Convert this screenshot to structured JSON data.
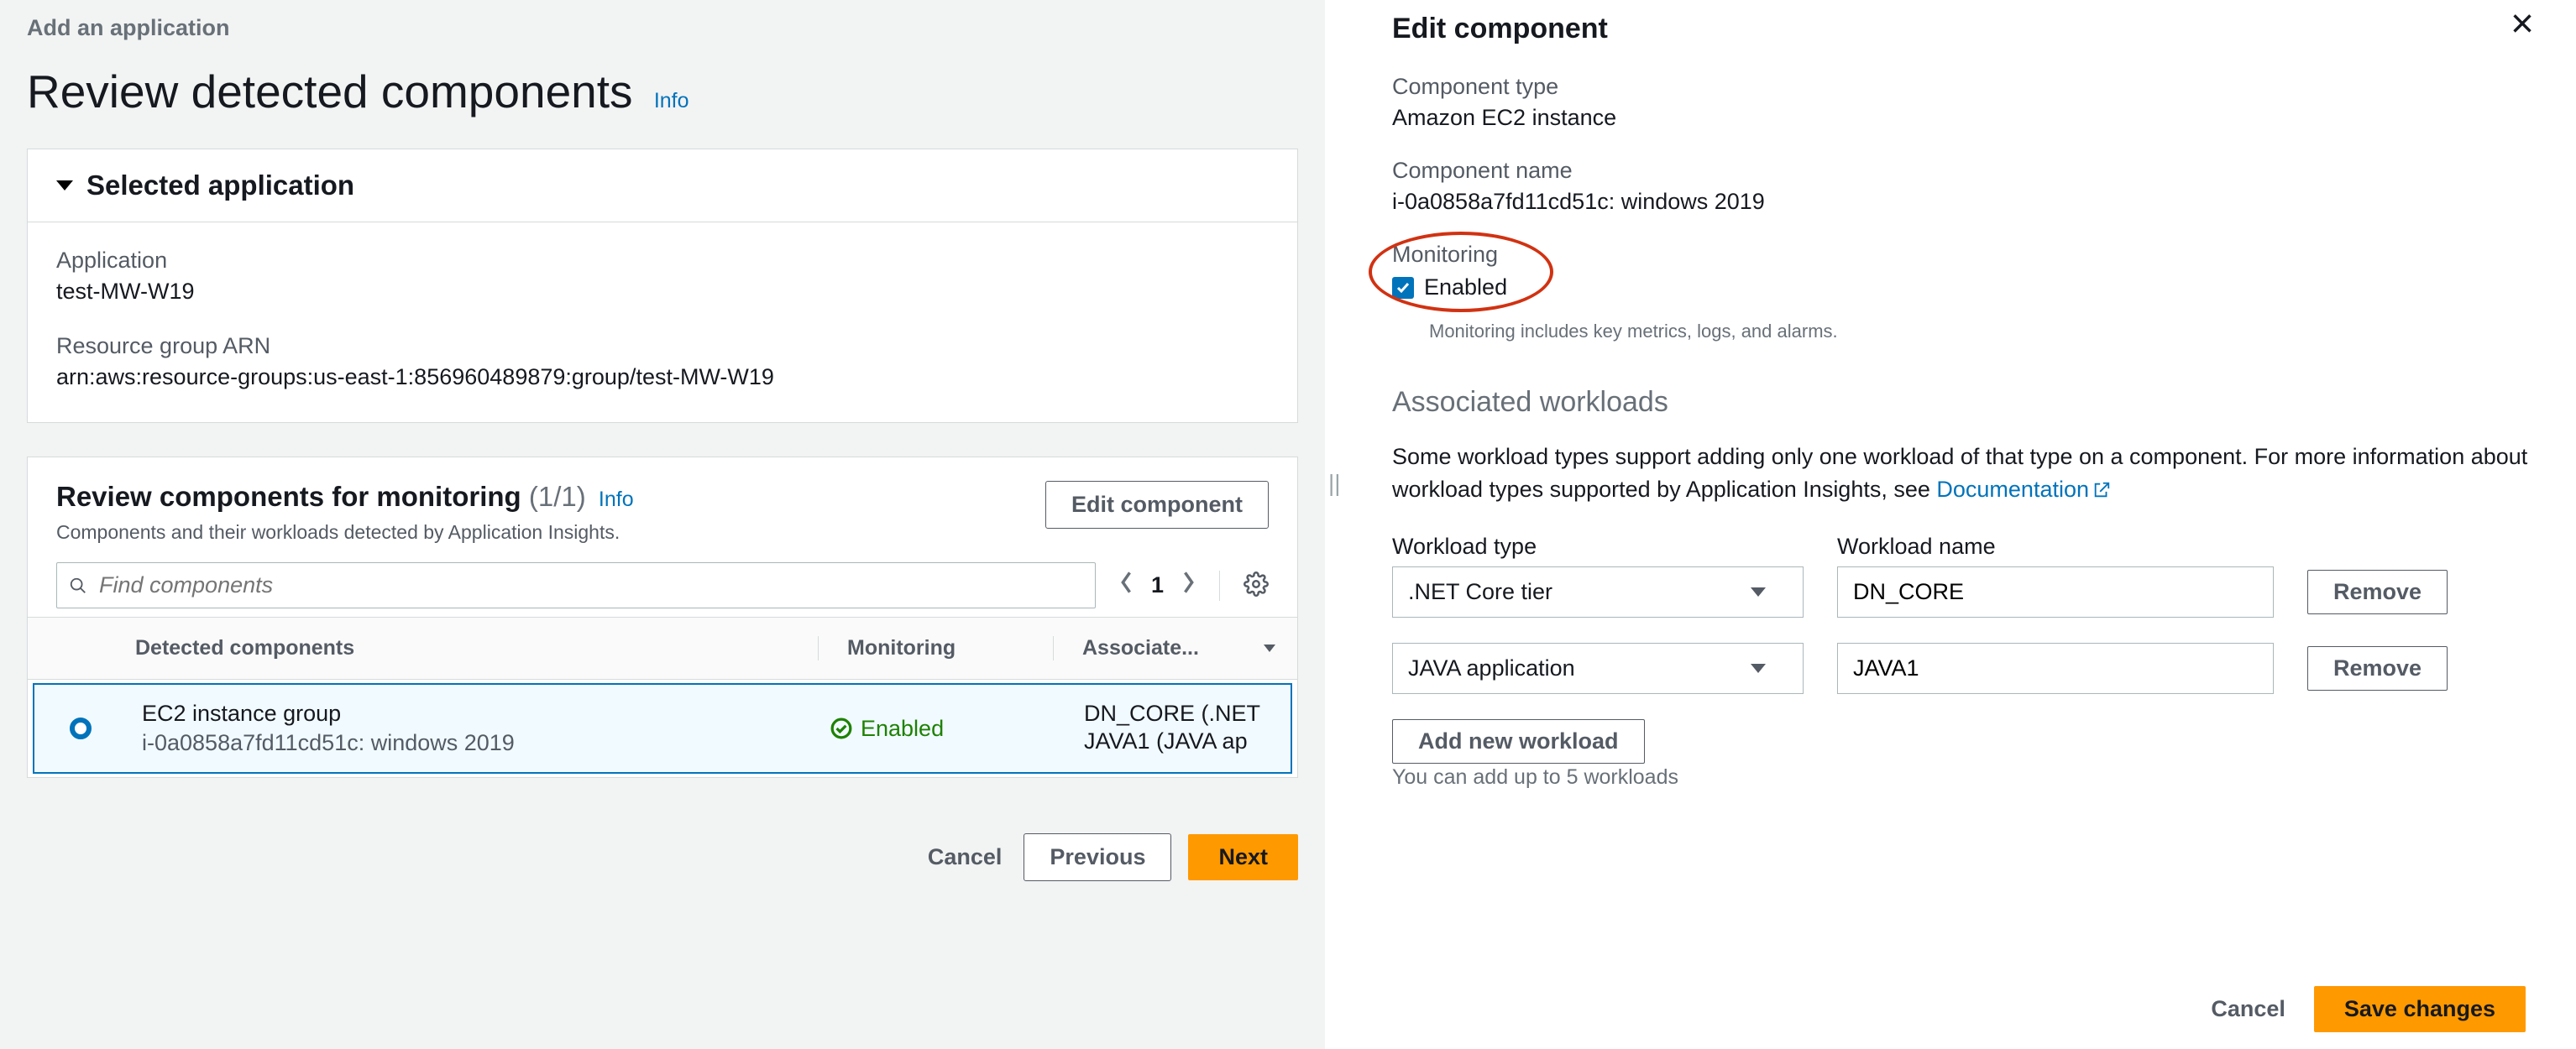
{
  "breadcrumb": "Add an application",
  "page_title": "Review detected components",
  "info_label": "Info",
  "selected_app": {
    "panel_title": "Selected application",
    "application_label": "Application",
    "application_value": "test-MW-W19",
    "arn_label": "Resource group ARN",
    "arn_value": "arn:aws:resource-groups:us-east-1:856960489879:group/test-MW-W19"
  },
  "review": {
    "title": "Review components for monitoring",
    "count": "(1/1)",
    "subtext": "Components and their workloads detected by Application Insights.",
    "edit_btn": "Edit component",
    "search_placeholder": "Find components",
    "page_num": "1",
    "headers": {
      "components": "Detected components",
      "monitoring": "Monitoring",
      "associated": "Associate..."
    },
    "row": {
      "name": "EC2 instance group",
      "sub": "i-0a0858a7fd11cd51c: windows 2019",
      "monitoring": "Enabled",
      "workloads": [
        "DN_CORE (.NET",
        "JAVA1 (JAVA ap"
      ]
    }
  },
  "footer": {
    "cancel": "Cancel",
    "previous": "Previous",
    "next": "Next"
  },
  "right": {
    "title": "Edit component",
    "component_type_label": "Component type",
    "component_type_value": "Amazon EC2 instance",
    "component_name_label": "Component name",
    "component_name_value": "i-0a0858a7fd11cd51c: windows 2019",
    "monitoring_label": "Monitoring",
    "monitoring_value": "Enabled",
    "monitoring_help": "Monitoring includes key metrics, logs, and alarms.",
    "assoc_title": "Associated workloads",
    "assoc_desc_pre": "Some workload types support adding only one workload of that type on a component. For more information about workload types supported by Application Insights, see ",
    "assoc_doc_link": "Documentation",
    "wl_type_header": "Workload type",
    "wl_name_header": "Workload name",
    "remove_label": "Remove",
    "rows": [
      {
        "type": ".NET Core tier",
        "name": "DN_CORE"
      },
      {
        "type": "JAVA application",
        "name": "JAVA1"
      }
    ],
    "add_btn": "Add new workload",
    "limit_text": "You can add up to 5 workloads",
    "cancel": "Cancel",
    "save": "Save changes"
  }
}
